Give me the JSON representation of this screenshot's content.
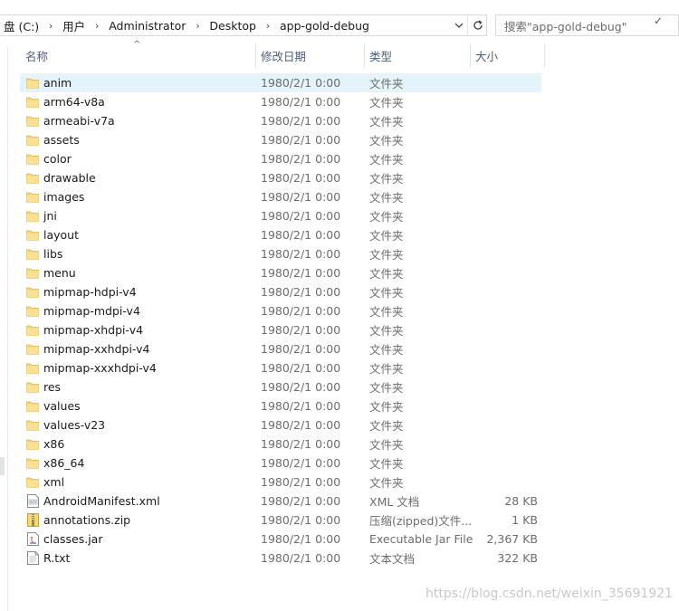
{
  "address": {
    "crumbs": [
      "盘 (C:)",
      "用户",
      "Administrator",
      "Desktop",
      "app-gold-debug"
    ]
  },
  "search": {
    "placeholder": "搜索\"app-gold-debug\""
  },
  "columns": {
    "name": "名称",
    "date": "修改日期",
    "type": "类型",
    "size": "大小"
  },
  "files": [
    {
      "name": "anim",
      "date": "1980/2/1 0:00",
      "type": "文件夹",
      "size": "",
      "icon": "folder-icon"
    },
    {
      "name": "arm64-v8a",
      "date": "1980/2/1 0:00",
      "type": "文件夹",
      "size": "",
      "icon": "folder-icon"
    },
    {
      "name": "armeabi-v7a",
      "date": "1980/2/1 0:00",
      "type": "文件夹",
      "size": "",
      "icon": "folder-icon"
    },
    {
      "name": "assets",
      "date": "1980/2/1 0:00",
      "type": "文件夹",
      "size": "",
      "icon": "folder-icon"
    },
    {
      "name": "color",
      "date": "1980/2/1 0:00",
      "type": "文件夹",
      "size": "",
      "icon": "folder-icon"
    },
    {
      "name": "drawable",
      "date": "1980/2/1 0:00",
      "type": "文件夹",
      "size": "",
      "icon": "folder-icon"
    },
    {
      "name": "images",
      "date": "1980/2/1 0:00",
      "type": "文件夹",
      "size": "",
      "icon": "folder-icon"
    },
    {
      "name": "jni",
      "date": "1980/2/1 0:00",
      "type": "文件夹",
      "size": "",
      "icon": "folder-icon"
    },
    {
      "name": "layout",
      "date": "1980/2/1 0:00",
      "type": "文件夹",
      "size": "",
      "icon": "folder-icon"
    },
    {
      "name": "libs",
      "date": "1980/2/1 0:00",
      "type": "文件夹",
      "size": "",
      "icon": "folder-icon"
    },
    {
      "name": "menu",
      "date": "1980/2/1 0:00",
      "type": "文件夹",
      "size": "",
      "icon": "folder-icon"
    },
    {
      "name": "mipmap-hdpi-v4",
      "date": "1980/2/1 0:00",
      "type": "文件夹",
      "size": "",
      "icon": "folder-icon"
    },
    {
      "name": "mipmap-mdpi-v4",
      "date": "1980/2/1 0:00",
      "type": "文件夹",
      "size": "",
      "icon": "folder-icon"
    },
    {
      "name": "mipmap-xhdpi-v4",
      "date": "1980/2/1 0:00",
      "type": "文件夹",
      "size": "",
      "icon": "folder-icon"
    },
    {
      "name": "mipmap-xxhdpi-v4",
      "date": "1980/2/1 0:00",
      "type": "文件夹",
      "size": "",
      "icon": "folder-icon"
    },
    {
      "name": "mipmap-xxxhdpi-v4",
      "date": "1980/2/1 0:00",
      "type": "文件夹",
      "size": "",
      "icon": "folder-icon"
    },
    {
      "name": "res",
      "date": "1980/2/1 0:00",
      "type": "文件夹",
      "size": "",
      "icon": "folder-icon"
    },
    {
      "name": "values",
      "date": "1980/2/1 0:00",
      "type": "文件夹",
      "size": "",
      "icon": "folder-icon"
    },
    {
      "name": "values-v23",
      "date": "1980/2/1 0:00",
      "type": "文件夹",
      "size": "",
      "icon": "folder-icon"
    },
    {
      "name": "x86",
      "date": "1980/2/1 0:00",
      "type": "文件夹",
      "size": "",
      "icon": "folder-icon"
    },
    {
      "name": "x86_64",
      "date": "1980/2/1 0:00",
      "type": "文件夹",
      "size": "",
      "icon": "folder-icon"
    },
    {
      "name": "xml",
      "date": "1980/2/1 0:00",
      "type": "文件夹",
      "size": "",
      "icon": "folder-icon"
    },
    {
      "name": "AndroidManifest.xml",
      "date": "1980/2/1 0:00",
      "type": "XML 文档",
      "size": "28 KB",
      "icon": "xml-file-icon"
    },
    {
      "name": "annotations.zip",
      "date": "1980/2/1 0:00",
      "type": "压缩(zipped)文件...",
      "size": "1 KB",
      "icon": "zip-file-icon"
    },
    {
      "name": "classes.jar",
      "date": "1980/2/1 0:00",
      "type": "Executable Jar File",
      "size": "2,367 KB",
      "icon": "jar-file-icon"
    },
    {
      "name": "R.txt",
      "date": "1980/2/1 0:00",
      "type": "文本文档",
      "size": "322 KB",
      "icon": "text-file-icon"
    }
  ],
  "selected_index": 0,
  "watermark": "https://blog.csdn.net/weixin_35691921",
  "colors": {
    "selection": "#e5f3fb",
    "header_text": "#4c607a",
    "folder": "#f8d775"
  }
}
